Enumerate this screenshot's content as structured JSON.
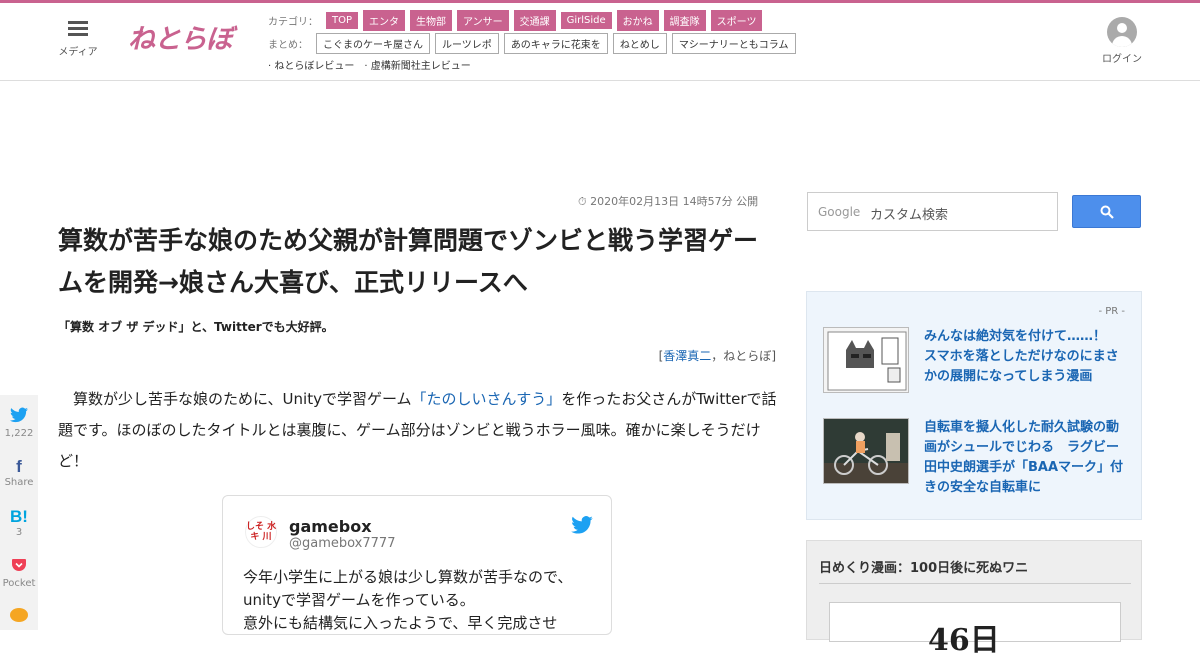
{
  "header": {
    "menu_label": "メディア",
    "logo_text": "ねとらぼ",
    "category_label": "カテゴリ：",
    "categories": [
      "TOP",
      "エンタ",
      "生物部",
      "アンサー",
      "交通課",
      "GirlSide",
      "おかね",
      "調査隊",
      "スポーツ"
    ],
    "summary_label": "まとめ：",
    "summaries": [
      "こぐまのケーキ屋さん",
      "ルーツレポ",
      "あのキャラに花束を",
      "ねとめし",
      "マシーナリーともコラム"
    ],
    "reviews": [
      "· ねとらぼレビュー",
      "· 虚構新聞社主レビュー"
    ],
    "login_label": "ログイン"
  },
  "article": {
    "published": "2020年02月13日 14時57分 公開",
    "title": "算数が苦手な娘のため父親が計算問題でゾンビと戦う学習ゲームを開発→娘さん大喜び、正式リリースへ",
    "subtitle": "「算数 オブ ザ デッド」と、Twitterでも大好評。",
    "byline_open": "[",
    "author": "香澤真二",
    "byline_sep": "，",
    "outlet": "ねとらぼ",
    "byline_close": "]",
    "body_pre": "算数が少し苦手な娘のために、Unityで学習ゲーム",
    "body_link": "「たのしいさんすう」",
    "body_post": "を作ったお父さんがTwitterで話題です。ほのぼのしたタイトルとは裏腹に、ゲーム部分はゾンビと戦うホラー風味。確かに楽しそうだけど！"
  },
  "share": {
    "twitter": {
      "icon": "twitter-icon",
      "count": "1,222"
    },
    "facebook": {
      "icon": "facebook-icon",
      "count": "Share"
    },
    "hatena": {
      "icon": "hatena-icon",
      "glyph": "B!",
      "count": "3"
    },
    "pocket": {
      "icon": "pocket-icon",
      "count": "Pocket"
    },
    "line": {
      "icon": "line-icon"
    }
  },
  "tweet": {
    "name": "gamebox",
    "handle": "@gamebox7777",
    "avatar_text": "しそ 水\nキ 川",
    "text": "今年小学生に上がる娘は少し算数が苦手なので、unityで学習ゲームを作っている。\n意外にも結構気に入ったようで、早く完成させ"
  },
  "sidebar": {
    "search_brand": "Google",
    "search_placeholder": "カスタム検索",
    "pr_label": "- PR -",
    "pr_items": [
      {
        "text": "みんなは絶対気を付けて……！　スマホを落としただけなのにまさかの展開になってしまう漫画"
      },
      {
        "text": "自転車を擬人化した耐久試験の動画がシュールでじわる　ラグビー田中史朗選手が「BAAマーク」付きの安全な自転車に"
      }
    ],
    "manga_title": "日めくり漫画：100日後に死ぬワニ",
    "manga_number": "46日"
  },
  "colors": {
    "brand_pink": "#c9628f",
    "link_blue": "#1a66b3",
    "search_blue": "#4d8fec",
    "twitter_blue": "#1da1f2"
  }
}
